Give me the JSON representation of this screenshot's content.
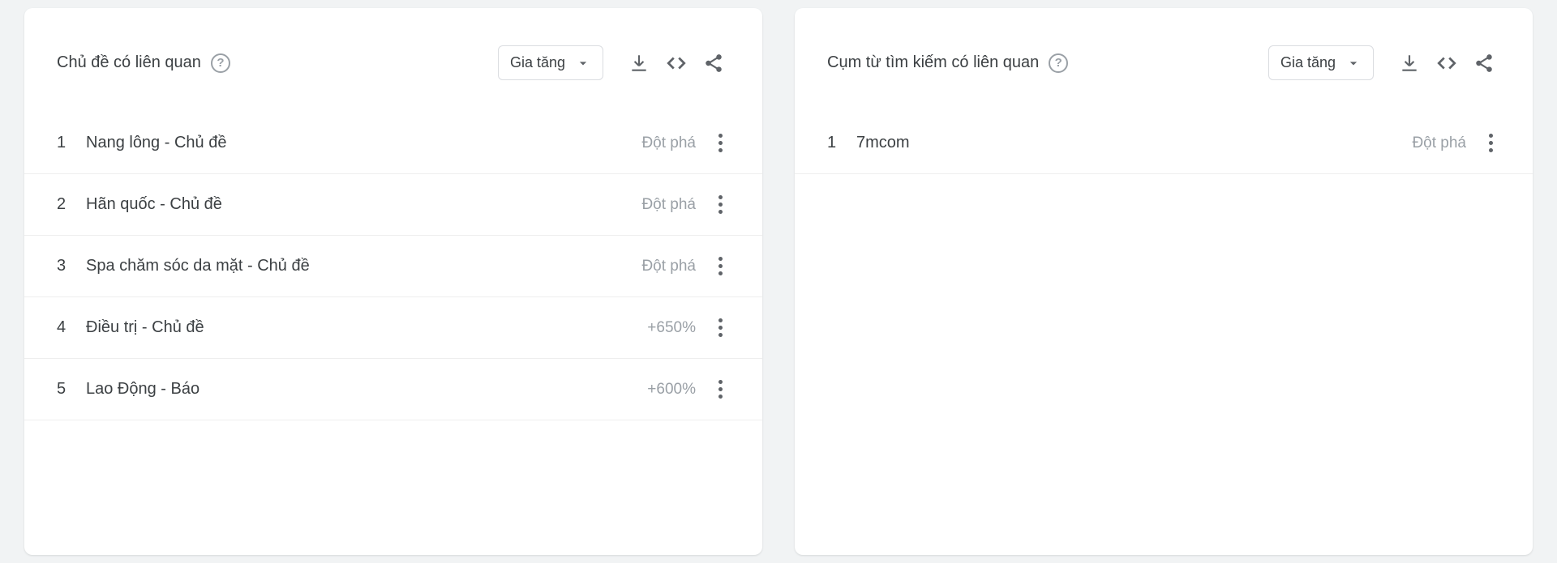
{
  "dropdowns": {
    "topics_sort": "Gia tăng",
    "queries_sort": "Gia tăng"
  },
  "cards": {
    "topics": {
      "title": "Chủ đề có liên quan",
      "rows": [
        {
          "rank": "1",
          "label": "Nang lông - Chủ đề",
          "value": "Đột phá"
        },
        {
          "rank": "2",
          "label": "Hãn quốc - Chủ đề",
          "value": "Đột phá"
        },
        {
          "rank": "3",
          "label": "Spa chăm sóc da mặt - Chủ đề",
          "value": "Đột phá"
        },
        {
          "rank": "4",
          "label": "Điều trị - Chủ đề",
          "value": "+650%"
        },
        {
          "rank": "5",
          "label": "Lao Động - Báo",
          "value": "+600%"
        }
      ]
    },
    "queries": {
      "title": "Cụm từ tìm kiếm có liên quan",
      "rows": [
        {
          "rank": "1",
          "label": "7mcom",
          "value": "Đột phá"
        }
      ]
    }
  }
}
